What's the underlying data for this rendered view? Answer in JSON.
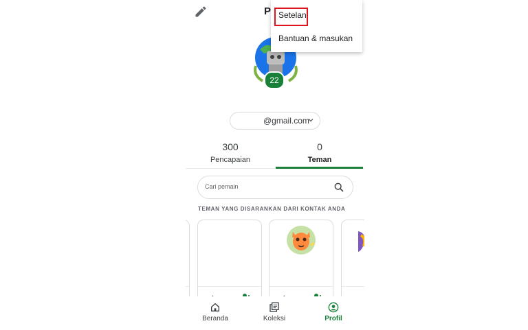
{
  "header": {
    "title": "Profil",
    "edit_icon": "pencil-icon"
  },
  "profile": {
    "avatar_icon": "robot-avatar-icon",
    "level": "22",
    "account_email": "@gmail.com",
    "account_chevron_icon": "chevron-down-icon"
  },
  "stats": {
    "achievements_value": "300",
    "achievements_label": "Pencapaian",
    "friends_value": "0",
    "friends_label": "Teman"
  },
  "search": {
    "placeholder": "Cari pemain",
    "icon": "search-icon"
  },
  "suggestions": {
    "heading": "TEMAN YANG DISARANKAN DARI KONTAK ANDA"
  },
  "menu": {
    "items": [
      {
        "label": "Setelan"
      },
      {
        "label": "Bantuan & masukan"
      }
    ]
  },
  "bottom_nav": {
    "items": [
      {
        "label": "Beranda",
        "icon": "home-icon"
      },
      {
        "label": "Koleksi",
        "icon": "library-icon"
      },
      {
        "label": "Profil",
        "icon": "account-circle-icon"
      }
    ],
    "active": "Profil"
  },
  "colors": {
    "accent": "#188038",
    "highlight": "#e0141e"
  }
}
